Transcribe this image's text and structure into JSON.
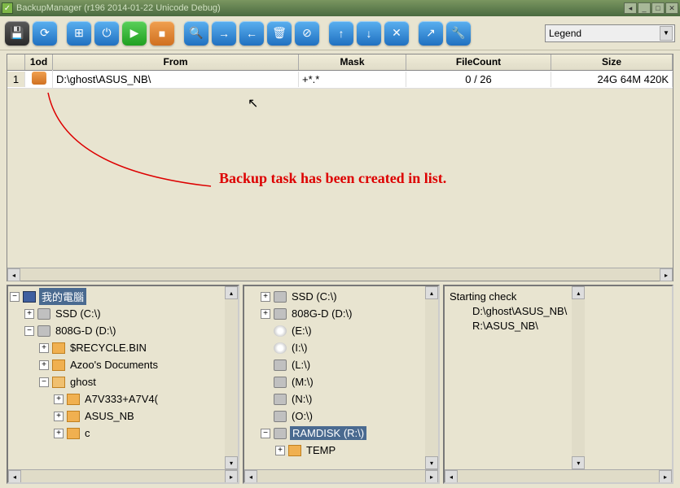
{
  "titlebar": {
    "text": "BackupManager (r196 2014-01-22 Unicode Debug)"
  },
  "legend": {
    "label": "Legend"
  },
  "grid": {
    "headers": {
      "num": "",
      "tod": "1od",
      "from": "From",
      "mask": "Mask",
      "filecount": "FileCount",
      "size": "Size"
    },
    "row": {
      "num": "1",
      "from": "D:\\ghost\\ASUS_NB\\",
      "mask": "+*.*",
      "filecount": "0 / 26",
      "size": "24G 64M 420K"
    }
  },
  "annotation": "Backup task has been created in list.",
  "tree_left": {
    "root": "我的電腦",
    "items": [
      {
        "label": "SSD (C:\\)"
      },
      {
        "label": "808G-D (D:\\)"
      },
      {
        "label": "$RECYCLE.BIN"
      },
      {
        "label": "Azoo's Documents"
      },
      {
        "label": "ghost"
      },
      {
        "label": "A7V333+A7V4("
      },
      {
        "label": "ASUS_NB"
      },
      {
        "label": "c"
      }
    ]
  },
  "tree_mid": {
    "items": [
      {
        "label": "SSD (C:\\)"
      },
      {
        "label": "808G-D (D:\\)"
      },
      {
        "label": "(E:\\)"
      },
      {
        "label": "(I:\\)"
      },
      {
        "label": "(L:\\)"
      },
      {
        "label": "(M:\\)"
      },
      {
        "label": "(N:\\)"
      },
      {
        "label": "(O:\\)"
      },
      {
        "label": "RAMDISK (R:\\)"
      },
      {
        "label": "TEMP"
      }
    ]
  },
  "log": {
    "line1": "Starting check",
    "line2": "D:\\ghost\\ASUS_NB\\",
    "line3": "R:\\ASUS_NB\\"
  }
}
